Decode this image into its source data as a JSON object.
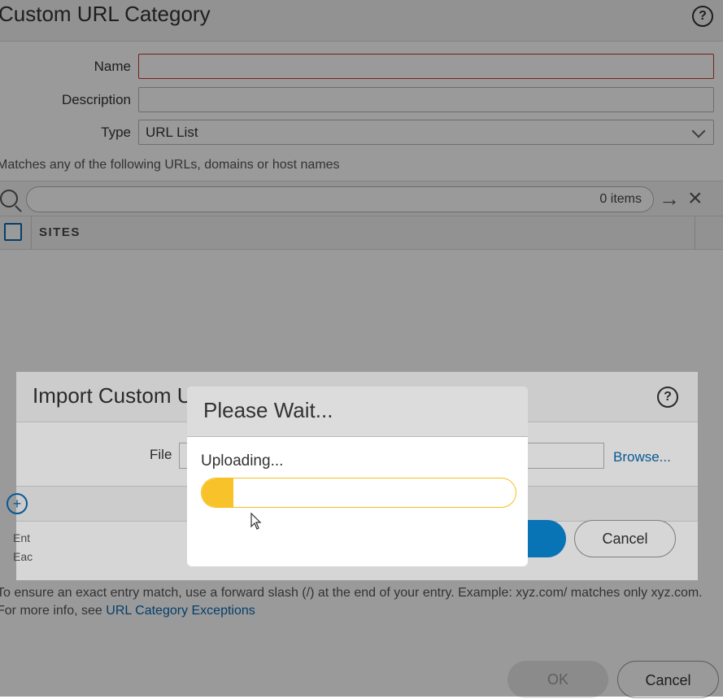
{
  "base_dialog": {
    "title": "Custom URL Category",
    "fields": {
      "name_label": "Name",
      "name_value": "",
      "description_label": "Description",
      "description_value": "",
      "type_label": "Type",
      "type_value": "URL List"
    },
    "hint": "Matches any of the following URLs, domains or host names",
    "search": {
      "items_count": "0 items"
    },
    "table": {
      "columns": [
        "SITES"
      ]
    },
    "note": {
      "text": "To ensure an exact entry match, use a forward slash (/) at the end of your entry. Example: xyz.com/ matches only xyz.com. For more info, see ",
      "link": "URL Category Exceptions"
    },
    "buttons": {
      "ok": "OK",
      "cancel": "Cancel"
    }
  },
  "import_dialog": {
    "title": "Import Custom U",
    "file_label": "File",
    "file_value": "",
    "browse": "Browse...",
    "fragment_line1": "Ent",
    "fragment_line2": "Eac",
    "buttons": {
      "cancel": "Cancel"
    }
  },
  "wait_dialog": {
    "title": "Please Wait...",
    "status": "Uploading...",
    "progress_fraction": 0.1
  },
  "icons": {
    "help": "help-icon",
    "search": "search-icon",
    "arrow": "arrow-right-icon",
    "close": "close-icon",
    "add": "add-icon",
    "chevron": "chevron-down-icon",
    "cursor": "mouse-cursor-icon"
  },
  "colors": {
    "progress": "#f8c22a",
    "link": "#0a6ab0",
    "primary": "#0a8ad8"
  }
}
